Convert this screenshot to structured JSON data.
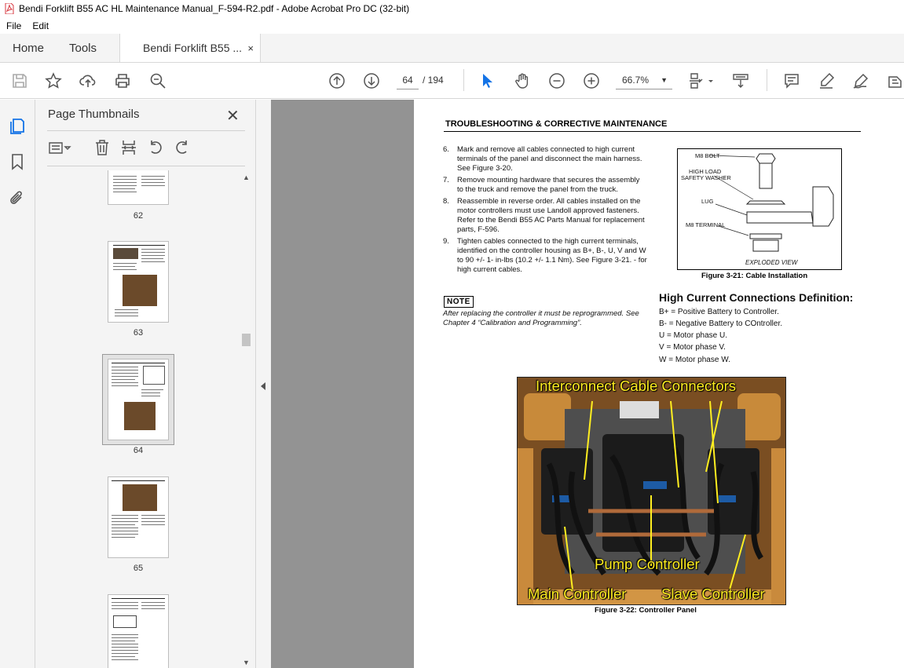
{
  "window": {
    "title": "Bendi Forklift B55 AC HL Maintenance Manual_F-594-R2.pdf - Adobe Acrobat Pro DC (32-bit)"
  },
  "menu": [
    "File",
    "Edit"
  ],
  "tabs": {
    "home": "Home",
    "tools": "Tools",
    "document": "Bendi Forklift B55 ...",
    "close": "×"
  },
  "toolbar": {
    "current_page": "64",
    "page_total": "/ 194",
    "zoom": "66.7%"
  },
  "panel": {
    "title": "Page Thumbnails",
    "close": "✕",
    "thumbnails": [
      {
        "label": "62"
      },
      {
        "label": "63"
      },
      {
        "label": "64",
        "selected": true
      },
      {
        "label": "65"
      }
    ]
  },
  "page": {
    "header": "TROUBLESHOOTING & CORRECTIVE MAINTENANCE",
    "steps": [
      {
        "num": "6.",
        "text": "Mark and remove all cables connected to high current terminals of the panel and disconnect the main harness. See Figure 3-20."
      },
      {
        "num": "7.",
        "text": "Remove mounting hardware that secures the assembly to the truck and remove the panel from the truck."
      },
      {
        "num": "8.",
        "text": "Reassemble in reverse order. All cables installed on the motor controllers must use Landoll approved fasteners. Refer to the Bendi B55 AC Parts Manual for replacement parts, F-596."
      },
      {
        "num": "9.",
        "text": "Tighten cables connected to the high current terminals, identified on the controller housing as B+, B-, U, V and W to 90 +/- 1- in-lbs (10.2 +/- 1.1 Nm). See Figure 3-21. - for high current cables."
      }
    ],
    "note_label": "NOTE",
    "note_text": "After replacing the controller it must be reprogrammed. See Chapter 4 “Calibration and Programming”.",
    "figure1": {
      "labels": {
        "bolt": "M8 BOLT",
        "washer1": "HIGH LOAD",
        "washer2": "SAFETY WASHER",
        "lug": "LUG",
        "terminal": "M8 TERMINAL",
        "view": "EXPLODED VIEW"
      },
      "caption": "Figure 3-21:  Cable Installation"
    },
    "hc_title": "High Current Connections Definition:",
    "hc_lines": [
      "B+ = Positive Battery to Controller.",
      "B- = Negative Battery to COntroller.",
      "U = Motor phase U.",
      "V = Motor phase V.",
      "W = Motor phase W."
    ],
    "figure2": {
      "callouts": {
        "top": "Interconnect Cable Connectors",
        "pump": "Pump Controller",
        "main": "Main Controller",
        "slave": "Slave Controller"
      },
      "caption": "Figure 3-22:   Controller Panel"
    }
  },
  "colors": {
    "accent_blue": "#1473e6",
    "pdf_red": "#d7373f",
    "callout_yellow": "#ffee20"
  }
}
